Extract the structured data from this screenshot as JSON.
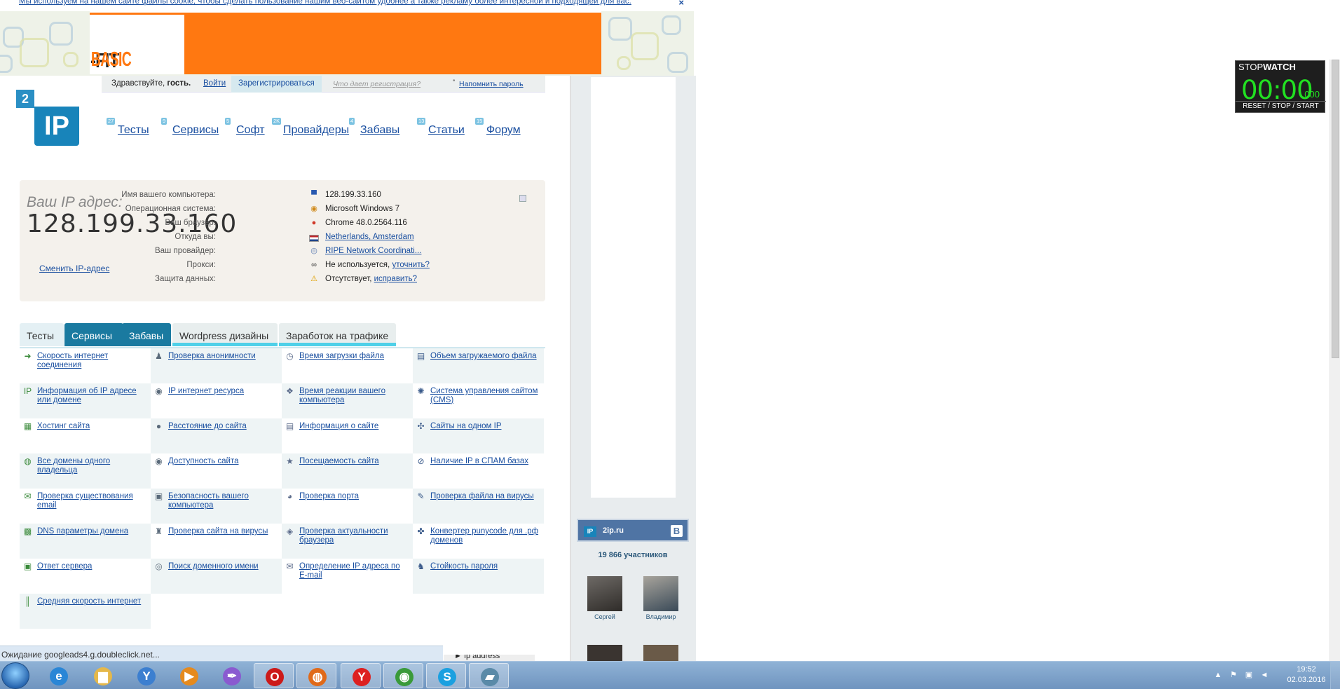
{
  "cookie_bar": {
    "text": "Мы используем на нашем сайте файлы cookie, чтобы сделать пользование нашим веб-сайтом удобнее а также рекламу более интересной и подходящей для вас.",
    "close": "×"
  },
  "ad_banner": {
    "brand_left": "BASIC",
    "brand_right": "-FIT"
  },
  "login_bar": {
    "greeting": "Здравствуйте,",
    "guest": "гость.",
    "login": "Войти",
    "register": "Зарегистрироваться",
    "why_register": "Что дает регистрация?",
    "remind_password": "Напомнить пароль"
  },
  "logo": {
    "badge": "2",
    "text": "IP"
  },
  "nav": [
    {
      "count": "27",
      "label": "Тесты"
    },
    {
      "count": "9",
      "label": "Сервисы"
    },
    {
      "count": "5",
      "label": "Софт"
    },
    {
      "count": "2K",
      "label": "Провайдеры"
    },
    {
      "count": "4",
      "label": "Забавы"
    },
    {
      "count": "13",
      "label": "Статьи"
    },
    {
      "count": "15",
      "label": "Форум"
    }
  ],
  "ip_panel": {
    "caption": "Ваш IP адрес:",
    "ip": "128.199.33.160",
    "change_link": "Сменить IP-адрес",
    "rows": [
      {
        "key": "Имя вашего компьютера:",
        "icon": "computer-icon",
        "glyph": "▀",
        "value": "128.199.33.160",
        "link": ""
      },
      {
        "key": "Операционная система:",
        "icon": "windows-icon",
        "glyph": "◉",
        "value": "Microsoft Windows 7",
        "link": ""
      },
      {
        "key": "Ваш браузер:",
        "icon": "chrome-icon",
        "glyph": "●",
        "value": "Chrome 48.0.2564.116",
        "link": ""
      },
      {
        "key": "Откуда вы:",
        "icon": "flag-nl-icon",
        "glyph": "▬",
        "value": "",
        "link": "Netherlands, Amsterdam"
      },
      {
        "key": "Ваш провайдер:",
        "icon": "provider-icon",
        "glyph": "◎",
        "value": "",
        "link": "RIPE Network Coordinati..."
      },
      {
        "key": "Прокси:",
        "icon": "glasses-icon",
        "glyph": "∞",
        "value": "Не используется,",
        "link": "уточнить?"
      },
      {
        "key": "Защита данных:",
        "icon": "warning-icon",
        "glyph": "⚠",
        "value": "Отсутствует,",
        "link": "исправить?"
      }
    ]
  },
  "tabs": [
    {
      "label": "Тесты"
    },
    {
      "label": "Сервисы"
    },
    {
      "label": "Забавы"
    },
    {
      "label": "Wordpress дизайны"
    },
    {
      "label": "Заработок на трафике"
    }
  ],
  "services": [
    {
      "label": "Скорость интернет соединения",
      "icon": "speed-icon",
      "glyph": "➜"
    },
    {
      "label": "Проверка анонимности",
      "icon": "anonymity-icon",
      "glyph": "♟"
    },
    {
      "label": "Время загрузки файла",
      "icon": "clock-icon",
      "glyph": "◷"
    },
    {
      "label": "Объем загружаемого файла",
      "icon": "file-size-icon",
      "glyph": "▤"
    },
    {
      "label": "Информация об IP адресе или домене",
      "icon": "ip-info-icon",
      "glyph": "IP"
    },
    {
      "label": "IP интернет ресурса",
      "icon": "ip-resource-icon",
      "glyph": "◉"
    },
    {
      "label": "Время реакции вашего компьютера",
      "icon": "reaction-icon",
      "glyph": "❖"
    },
    {
      "label": "Система управления сайтом (CMS)",
      "icon": "cms-icon",
      "glyph": "✺"
    },
    {
      "label": "Хостинг сайта",
      "icon": "hosting-icon",
      "glyph": "▦"
    },
    {
      "label": "Расстояние до сайта",
      "icon": "pin-icon",
      "glyph": "●"
    },
    {
      "label": "Информация о сайте",
      "icon": "site-info-icon",
      "glyph": "▤"
    },
    {
      "label": "Сайты на одном IP",
      "icon": "network-icon",
      "glyph": "✣"
    },
    {
      "label": "Все домены одного владельца",
      "icon": "domains-icon",
      "glyph": "◍"
    },
    {
      "label": "Доступность сайта",
      "icon": "availability-icon",
      "glyph": "◉"
    },
    {
      "label": "Посещаемость сайта",
      "icon": "star-icon",
      "glyph": "★"
    },
    {
      "label": "Наличие IP в СПАМ базах",
      "icon": "spam-icon",
      "glyph": "⊘"
    },
    {
      "label": "Проверка существования email",
      "icon": "email-icon",
      "glyph": "✉"
    },
    {
      "label": "Безопасность вашего компьютера",
      "icon": "lock-icon",
      "glyph": "▣"
    },
    {
      "label": "Проверка порта",
      "icon": "port-icon",
      "glyph": "◕"
    },
    {
      "label": "Проверка файла на вирусы",
      "icon": "file-virus-icon",
      "glyph": "✎"
    },
    {
      "label": "DNS параметры домена",
      "icon": "dns-icon",
      "glyph": "▩"
    },
    {
      "label": "Проверка сайта на вирусы",
      "icon": "site-virus-icon",
      "glyph": "♜"
    },
    {
      "label": "Проверка актуальности браузера",
      "icon": "browser-icon",
      "glyph": "◈"
    },
    {
      "label": "Конвертер punycode для .рф доменов",
      "icon": "punycode-icon",
      "glyph": "✤"
    },
    {
      "label": "Ответ сервера",
      "icon": "server-icon",
      "glyph": "▣"
    },
    {
      "label": "Поиск доменного имени",
      "icon": "domain-search-icon",
      "glyph": "◎"
    },
    {
      "label": "Определение IP адреса по E-mail",
      "icon": "email-ip-icon",
      "glyph": "✉"
    },
    {
      "label": "Стойкость пароля",
      "icon": "password-icon",
      "glyph": "♞"
    },
    {
      "label": "Средняя скорость интернет",
      "icon": "avg-speed-icon",
      "glyph": "║"
    }
  ],
  "vk_widget": {
    "name": "2ip.ru",
    "vk_letter": "В",
    "members": "19 866 участников",
    "people": [
      "Сергей",
      "Владимир"
    ]
  },
  "stopwatch": {
    "title_light": "STOP",
    "title_bold": "WATCH",
    "time": "00:00",
    "ms": ".000",
    "controls": "RESET / STOP / START"
  },
  "status": {
    "text": "Ожидание googleads4.g.doubleclick.net...",
    "partial": "► Ip address"
  },
  "taskbar": {
    "apps": [
      {
        "name": "ie-icon",
        "glyph": "e",
        "color": "#2a86d6"
      },
      {
        "name": "explorer-icon",
        "glyph": "▆",
        "color": "#e5b84a"
      },
      {
        "name": "yandex-browser-icon",
        "glyph": "Y",
        "color": "#3c7fd0"
      },
      {
        "name": "media-icon",
        "glyph": "▶",
        "color": "#e58a1e"
      },
      {
        "name": "feather-icon",
        "glyph": "✒",
        "color": "#8a5ad0"
      },
      {
        "name": "opera-icon",
        "glyph": "O",
        "color": "#cc1a1a"
      },
      {
        "name": "firefox-icon",
        "glyph": "◍",
        "color": "#e06a1a"
      },
      {
        "name": "yandex-icon",
        "glyph": "Y",
        "color": "#dd2020"
      },
      {
        "name": "chrome-icon",
        "glyph": "◉",
        "color": "#3a9a3a"
      },
      {
        "name": "skype-icon",
        "glyph": "S",
        "color": "#1aa0e0"
      },
      {
        "name": "notes-icon",
        "glyph": "▰",
        "color": "#5a8aa8"
      }
    ],
    "time": "19:52",
    "date": "02.03.2016"
  }
}
